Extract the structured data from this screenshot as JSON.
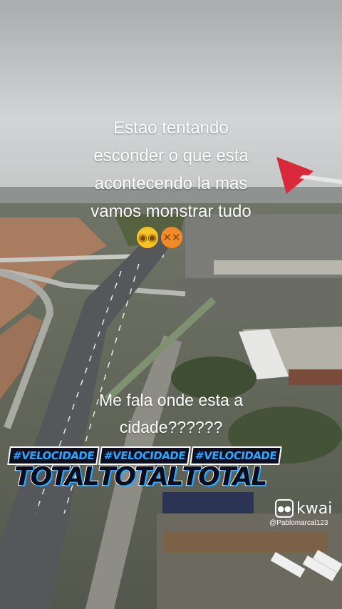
{
  "caption_top": [
    "Estao tentando",
    "esconder o que esta",
    "acontecendo la mas",
    "vamos monstrar tudo"
  ],
  "caption_mid": [
    "Me fala onde esta a",
    "cidade??????"
  ],
  "emojis": [
    {
      "icon": "flushed-face-icon",
      "glyph": "◉◉"
    },
    {
      "icon": "angry-face-icon",
      "glyph": "✕✕"
    }
  ],
  "hashtags": [
    "#VELOCIDADE",
    "#VELOCIDADE",
    "#VELOCIDADE"
  ],
  "totals": [
    "TOTAL",
    "TOTAL",
    "TOTAL"
  ],
  "watermark": {
    "brand": "kwai",
    "user": "@Pablomarcal123"
  },
  "colors": {
    "sky": "#c9cbcc",
    "flood_water": "#a67a5e",
    "accent_blue": "#2aa8ff",
    "wing_red": "#d8283a"
  }
}
